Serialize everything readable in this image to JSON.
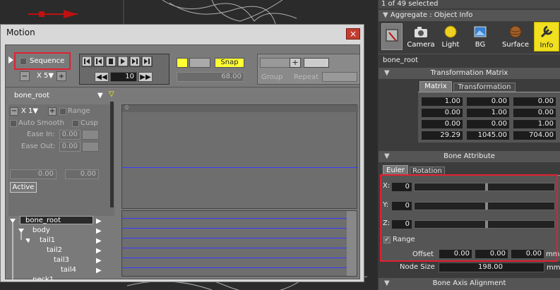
{
  "top": {
    "selection": "1 of 49 selected",
    "panel_title": "Aggregate : Object Info"
  },
  "tabs": [
    {
      "label": "Camera"
    },
    {
      "label": "Light"
    },
    {
      "label": "BG"
    },
    {
      "label": "Surface"
    },
    {
      "label": "Info"
    }
  ],
  "info": {
    "object_name": "bone_root",
    "matrix_section": "Transformation Matrix",
    "matrix_tab": "Matrix",
    "transformation_tab": "Transformation",
    "matrix": [
      [
        "1.00",
        "0.00",
        "0.00"
      ],
      [
        "0.00",
        "1.00",
        "0.00"
      ],
      [
        "0.00",
        "0.00",
        "1.00"
      ],
      [
        "29.29",
        "1045.00",
        "704.00"
      ]
    ],
    "bone_section": "Bone Attribute",
    "euler_tab": "Euler",
    "rotation_tab": "Rotation",
    "x_label": "X:",
    "y_label": "Y:",
    "z_label": "Z:",
    "x_val": "0",
    "y_val": "0",
    "z_val": "0",
    "range_label": "Range",
    "offset_label": "Offset",
    "offset": [
      "0.00",
      "0.00",
      "0.00"
    ],
    "offset_unit": "mm",
    "node_size_label": "Node Size",
    "node_size": "198.00",
    "node_size_unit": "mm",
    "bone_axis_section": "Bone Axis Alignment"
  },
  "motion": {
    "title": "Motion",
    "close": "×",
    "sequence_label": "Sequence",
    "x5": "X 5▼",
    "minus": "−",
    "plus": "+",
    "frame": "10",
    "snap": "Snap",
    "time_field": "68.00",
    "group": "Group",
    "repeat": "Repeat",
    "bone_name": "bone_root",
    "ruler_start": "0",
    "x1": "X 1▼",
    "range_label": "Range",
    "auto_smooth": "Auto Smooth",
    "cusp": "Cusp",
    "ease_in_label": "Ease In:",
    "ease_in": "0.00",
    "ease_out_label": "Ease Out:",
    "ease_out": "0.00",
    "val_a": "0.00",
    "val_b": "0.00",
    "active": "Active",
    "tree": [
      {
        "name": "bone_root",
        "depth": 0
      },
      {
        "name": "body",
        "depth": 1
      },
      {
        "name": "tail1",
        "depth": 2
      },
      {
        "name": "tail2",
        "depth": 3
      },
      {
        "name": "tail3",
        "depth": 4
      },
      {
        "name": "tail4",
        "depth": 5
      },
      {
        "name": "neck1",
        "depth": 1
      }
    ]
  },
  "colors": {
    "accent_red": "#e02030",
    "snap_yellow": "#ffff33",
    "info_yellow": "#f0e020",
    "track_blue": "#3a3aff"
  }
}
